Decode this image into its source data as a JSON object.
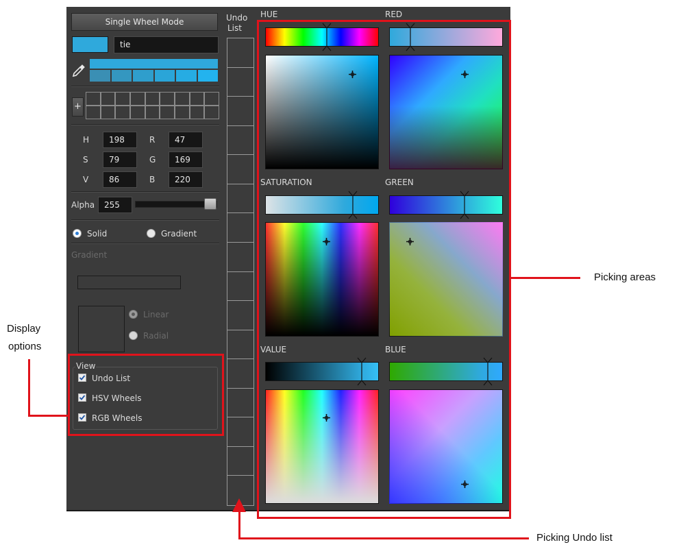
{
  "left_panel": {
    "mode_button": "Single Wheel Mode",
    "color_name": "tie",
    "current_color": "#2fa9dc",
    "hsv": {
      "h_label": "H",
      "h": "198",
      "s_label": "S",
      "s": "79",
      "v_label": "V",
      "v": "86"
    },
    "rgb": {
      "r_label": "R",
      "r": "47",
      "g_label": "G",
      "g": "169",
      "b_label": "B",
      "b": "220"
    },
    "alpha_label": "Alpha",
    "alpha_value": "255",
    "alpha_slider_fraction": 1.0,
    "fill_solid_label": "Solid",
    "fill_gradient_label": "Gradient",
    "gradient_section_label": "Gradient",
    "gradient_linear_label": "Linear",
    "gradient_radial_label": "Radial",
    "view_group_label": "View",
    "view_options": [
      {
        "label": "Undo List",
        "checked": true
      },
      {
        "label": "HSV Wheels",
        "checked": true
      },
      {
        "label": "RGB Wheels",
        "checked": true
      }
    ]
  },
  "undo_list": {
    "label_line1": "Undo",
    "label_line2": "List",
    "slot_count": 16
  },
  "picking": {
    "hue_label": "HUE",
    "saturation_label": "SATURATION",
    "value_label": "VALUE",
    "red_label": "RED",
    "green_label": "GREEN",
    "blue_label": "BLUE"
  },
  "annotations": {
    "picking_areas": "Picking areas",
    "display_options_line1": "Display",
    "display_options_line2": "options",
    "picking_undo_list": "Picking Undo list",
    "highlight_color": "#e0131b"
  }
}
